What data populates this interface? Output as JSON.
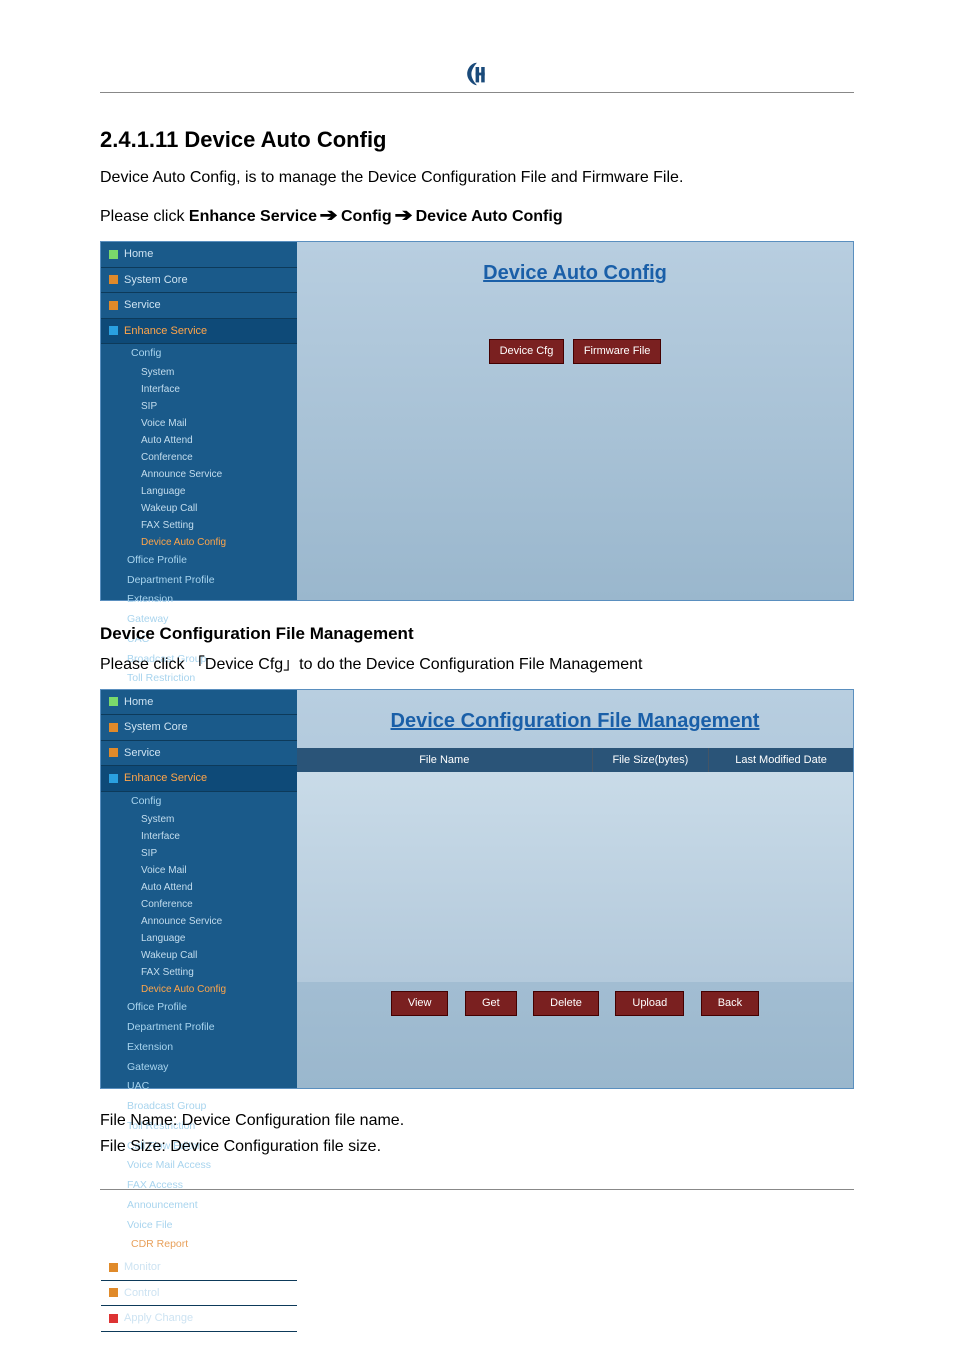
{
  "section_heading": "2.4.1.11 Device Auto Config",
  "intro1": "Device Auto Config, is to manage the Device Configuration File and Firmware File.",
  "intro2_parts": {
    "t1": "Please click ",
    "t2": "Enhance Service ",
    "t3": " Config ",
    "t4": " Device Auto Config"
  },
  "shot1": {
    "title": "Device Auto Config",
    "btn1": "Device Cfg",
    "btn2": "Firmware File"
  },
  "sidebar": {
    "home": "Home",
    "system_core": "System Core",
    "service": "Service",
    "enhance_service": "Enhance Service",
    "config": "Config",
    "subs": [
      "System",
      "Interface",
      "SIP",
      "Voice Mail",
      "Auto Attend",
      "Conference",
      "Announce Service",
      "Language",
      "Wakeup Call",
      "FAX Setting"
    ],
    "hl": "Device Auto Config",
    "mids": [
      "Office Profile",
      "Department Profile",
      "Extension",
      "Gateway",
      "UAC",
      "Broadcast Group",
      "Toll Restriction",
      "Call Flow Editor",
      "Voice Mail Access",
      "FAX Access",
      "Announcement",
      "Voice File"
    ],
    "cdr": "CDR Report",
    "monitor": "Monitor",
    "control": "Control",
    "apply": "Apply Change"
  },
  "mgmt_heading": "Device Configuration File Management",
  "mgmt_click": "Please click 「Device Cfg」to do the Device Configuration File Management",
  "shot2": {
    "title": "Device Configuration File Management",
    "cols": {
      "c1": "File Name",
      "c2": "File Size(bytes)",
      "c3": "Last Modified Date"
    },
    "btns": {
      "b1": "View",
      "b2": "Get",
      "b3": "Delete",
      "b4": "Upload",
      "b5": "Back"
    }
  },
  "desc1": "File Name: Device Configuration file name.",
  "desc2": "File Size: Device Configuration file size."
}
